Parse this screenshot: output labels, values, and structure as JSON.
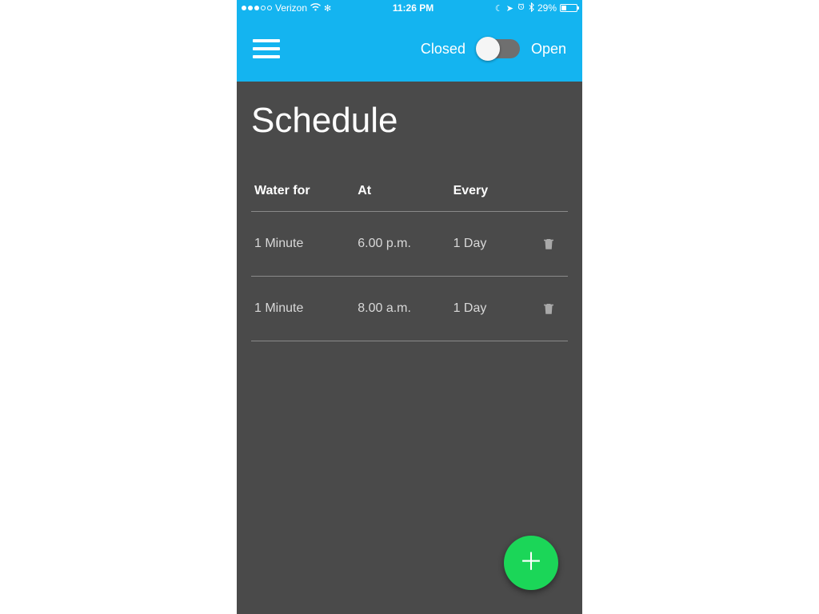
{
  "status": {
    "carrier": "Verizon",
    "time": "11:26 PM",
    "battery_pct": "29%"
  },
  "header": {
    "closed_label": "Closed",
    "open_label": "Open"
  },
  "page": {
    "title": "Schedule"
  },
  "table": {
    "headers": {
      "water_for": "Water for",
      "at": "At",
      "every": "Every"
    },
    "rows": [
      {
        "water_for": "1 Minute",
        "at": "6.00 p.m.",
        "every": "1 Day"
      },
      {
        "water_for": "1 Minute",
        "at": "8.00 a.m.",
        "every": "1 Day"
      }
    ]
  },
  "colors": {
    "accent": "#14b4f0",
    "fab": "#1bd658",
    "bg": "#4a4a4a"
  }
}
